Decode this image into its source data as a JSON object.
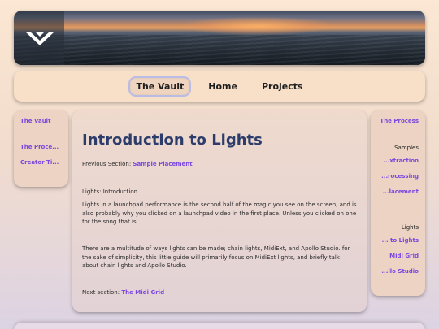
{
  "header": {
    "logo_icon": "chevron-v-logo-icon"
  },
  "nav": {
    "items": [
      {
        "label": "The Vault",
        "active": true
      },
      {
        "label": "Home",
        "active": false
      },
      {
        "label": "Projects",
        "active": false
      }
    ]
  },
  "left_sidebar": {
    "title": "The Vault",
    "links": [
      "The Proce...",
      "Creator Ti..."
    ]
  },
  "right_sidebar": {
    "title": "The Process",
    "group1_label": "Samples",
    "group1_links": [
      "...xtraction",
      "...rocessing",
      "...lacement"
    ],
    "group2_label": "Lights",
    "group2_links": [
      "... to Lights",
      "Midi Grid",
      "...llo Studio"
    ]
  },
  "main": {
    "title": "Introduction to Lights",
    "prev_prefix": "Previous Section: ",
    "prev_link": "Sample Placement",
    "subheading": "Lights: Introduction",
    "para1": "Lights in a launchpad performance is the second half of the magic you see on the screen, and is also probably why you clicked on a launchpad video in the first place. Unless you clicked on one for the song that is.",
    "para2": "There are a multitude of ways lights can be made; chain lights, MidiExt, and Apollo Studio. for the sake of simplicity, this little guide will primarily focus on MidiExt lights, and briefly talk about chain lights and Apollo Studio.",
    "next_prefix": "Next section: ",
    "next_link": "The Midi Grid"
  },
  "colors": {
    "link": "#7b47e0",
    "title": "#2d3d6b",
    "nav_bg": "#f7e0c7",
    "active_outline": "#b9bde6"
  }
}
